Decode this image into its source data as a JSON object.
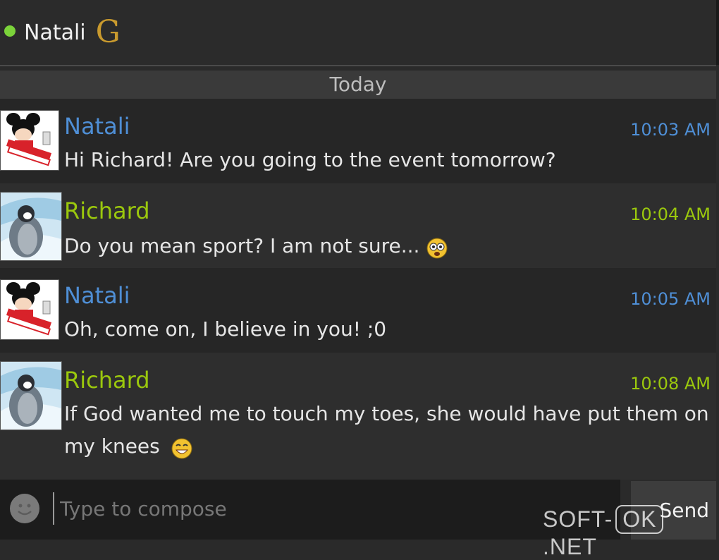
{
  "header": {
    "contact_name": "Natali",
    "status": "online",
    "status_color": "#7bd33a",
    "network_icon": "g-icon"
  },
  "day_divider": "Today",
  "messages": [
    {
      "sender": "Natali",
      "time": "10:03 AM",
      "text": "Hi Richard! Are you going to the event tomorrow?",
      "avatar": "pucca-avatar",
      "emoji": null
    },
    {
      "sender": "Richard",
      "time": "10:04 AM",
      "text": "Do you mean sport? I am not sure...",
      "avatar": "penguin-avatar",
      "emoji": "confused-emoji"
    },
    {
      "sender": "Natali",
      "time": "10:05 AM",
      "text": "Oh, come on, I believe in you! ;0",
      "avatar": "pucca-avatar",
      "emoji": null
    },
    {
      "sender": "Richard",
      "time": "10:08 AM",
      "text": "If God wanted me to touch my toes, she would have put them on",
      "text2": "my knees",
      "avatar": "penguin-avatar",
      "emoji": "laughing-emoji"
    }
  ],
  "colors": {
    "natali_accent": "#4f8fd6",
    "richard_accent": "#9bc80d",
    "logo_gold": "#c99a2e"
  },
  "compose": {
    "placeholder": "Type to compose",
    "send_label": "Send",
    "emoji_button_icon": "smiley-icon"
  },
  "watermark": {
    "left": "SOFT-",
    "boxed": "OK",
    "right": ".NET"
  }
}
